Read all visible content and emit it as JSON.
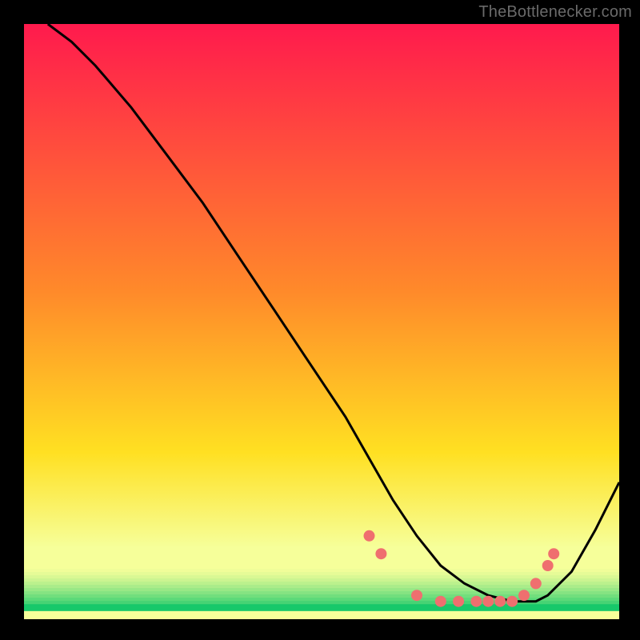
{
  "watermark": "TheBottlenecker.com",
  "plot": {
    "margin": 30,
    "innerWidth": 744,
    "innerHeight": 744
  },
  "chart_data": {
    "type": "line",
    "title": "",
    "xlabel": "",
    "ylabel": "",
    "xlim": [
      0,
      100
    ],
    "ylim": [
      0,
      100
    ],
    "background": {
      "gradient_top_color": "#ff1a4d",
      "gradient_mid_color": "#ffe022",
      "gradient_low_color": "#f6ff9a",
      "gradient_green_color": "#17c86a",
      "green_band_top_y": 9,
      "green_band_bottom_y": 2
    },
    "series": [
      {
        "name": "bottleneck-curve",
        "stroke": "#000000",
        "x": [
          4,
          8,
          12,
          18,
          24,
          30,
          36,
          42,
          48,
          54,
          58,
          62,
          66,
          70,
          74,
          78,
          82,
          84,
          86,
          88,
          92,
          96,
          100
        ],
        "y": [
          100,
          97,
          93,
          86,
          78,
          70,
          61,
          52,
          43,
          34,
          27,
          20,
          14,
          9,
          6,
          4,
          3,
          3,
          3,
          4,
          8,
          15,
          23
        ]
      }
    ],
    "markers": {
      "name": "tolerance-dots",
      "fill": "#ef6f6f",
      "radius": 7,
      "x": [
        58,
        60,
        66,
        70,
        73,
        76,
        78,
        80,
        82,
        84,
        86,
        88,
        89
      ],
      "y": [
        14,
        11,
        4,
        3,
        3,
        3,
        3,
        3,
        3,
        4,
        6,
        9,
        11
      ]
    }
  }
}
